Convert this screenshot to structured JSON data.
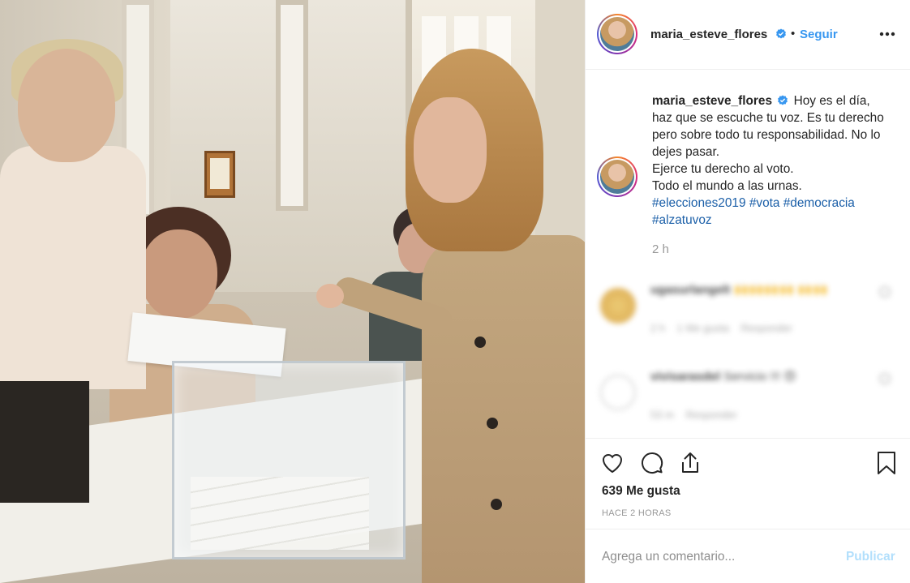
{
  "post": {
    "image_alt": "Mujer depositando su voto en una urna transparente en un colegio electoral"
  },
  "header": {
    "username": "maria_esteve_flores",
    "separator": "•",
    "follow_label": "Seguir",
    "more_icon": "more-horizontal-icon",
    "verified_icon": "verified-badge-icon"
  },
  "caption": {
    "username": "maria_esteve_flores",
    "lines": [
      "Hoy es el día, haz que se escuche tu voz. Es tu derecho pero sobre todo tu responsabilidad. No lo dejes pasar.",
      "Ejerce tu derecho al voto.",
      "Todo el mundo a las urnas."
    ],
    "hashtags": [
      "#elecciones2019",
      "#vota",
      "#democracia",
      "#alzatuvoz"
    ],
    "time": "2 h"
  },
  "comments": [
    {
      "username": "ugasurlangelt",
      "text": "🙌🙌🙌🙌 🙌🙌",
      "time": "2 h",
      "likes": "1 Me gusta",
      "reply": "Responder"
    },
    {
      "username": "vivisarasdel",
      "text": "Servicio !!! 😍",
      "time": "53 m",
      "reply": "Responder"
    }
  ],
  "actions": {
    "like_icon": "heart-icon",
    "comment_icon": "comment-icon",
    "share_icon": "share-icon",
    "save_icon": "bookmark-icon",
    "likes_text": "639 Me gusta",
    "time_ago": "HACE 2 HORAS"
  },
  "add_comment": {
    "placeholder": "Agrega un comentario...",
    "publish_label": "Publicar"
  },
  "colors": {
    "link": "#3897f0",
    "hashtag": "#1b5fa8",
    "muted": "#999999",
    "publish_disabled": "#b2dffc"
  }
}
